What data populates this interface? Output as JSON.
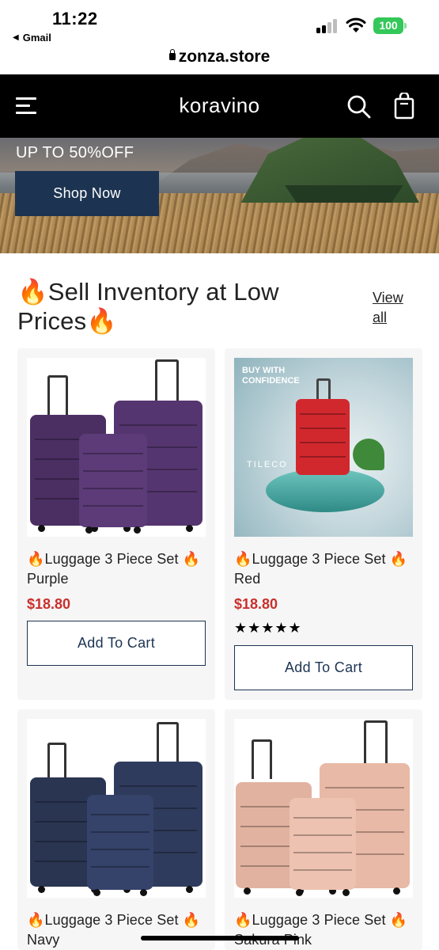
{
  "status_bar": {
    "time": "11:22",
    "back_app": "Gmail",
    "battery": "100"
  },
  "browser": {
    "url": "zonza.store"
  },
  "header": {
    "brand": "koravino",
    "icons": [
      "menu-icon",
      "search-icon",
      "shopping-bag-icon"
    ]
  },
  "hero": {
    "headline": "UP TO 50%OFF",
    "cta": "Shop Now"
  },
  "section": {
    "title": "🔥Sell Inventory at Low Prices🔥",
    "view_all": "View all"
  },
  "products": [
    {
      "title": "🔥Luggage 3 Piece Set 🔥Purple",
      "price": "$18.80",
      "rating": "★★★★★",
      "add_to_cart": "Add To Cart",
      "color": "#4b2f63"
    },
    {
      "title": "🔥Luggage 3 Piece Set 🔥Red",
      "price": "$18.80",
      "rating": "★★★★★",
      "add_to_cart": "Add To Cart",
      "color": "#d1282e",
      "image_text": {
        "headline": "BUY WITH CONFIDENCE",
        "brand": "TILECO"
      }
    },
    {
      "title": "🔥Luggage 3 Piece Set 🔥Navy",
      "color": "#2a3552"
    },
    {
      "title": "🔥Luggage 3 Piece Set 🔥Sakura Pink",
      "color": "#e2b2a0"
    }
  ],
  "colors": {
    "header_bg": "#000000",
    "accent_navy": "#1c3452",
    "price_red": "#c9302c",
    "battery_green": "#34c759"
  }
}
